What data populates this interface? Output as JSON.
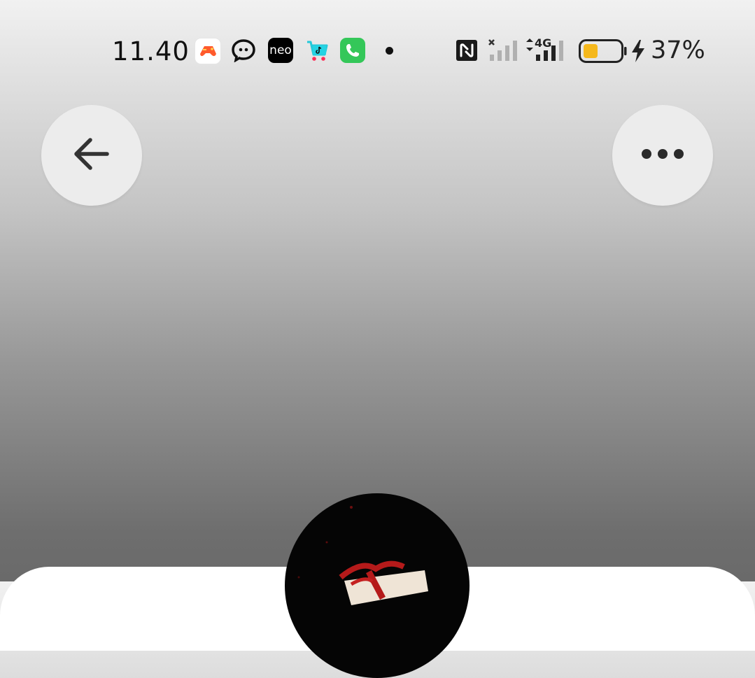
{
  "status_bar": {
    "time": "11.40",
    "notification_icons": [
      "game-app-icon",
      "chat-app-icon",
      "neo-app-icon",
      "tiktok-shop-app-icon",
      "phone-app-icon"
    ],
    "neo_label": "neo",
    "network_label": "4G",
    "battery_percent": "37%",
    "battery_level": 0.37,
    "battery_color": "#f5b81c"
  },
  "header": {
    "back_icon": "arrow-left-icon",
    "more_icon": "more-dots-icon"
  },
  "colors": {
    "button_bg": "#ececec",
    "phone_green": "#34c759",
    "tiktok_cyan": "#25f4ee",
    "tiktok_pink": "#fe2c55"
  }
}
